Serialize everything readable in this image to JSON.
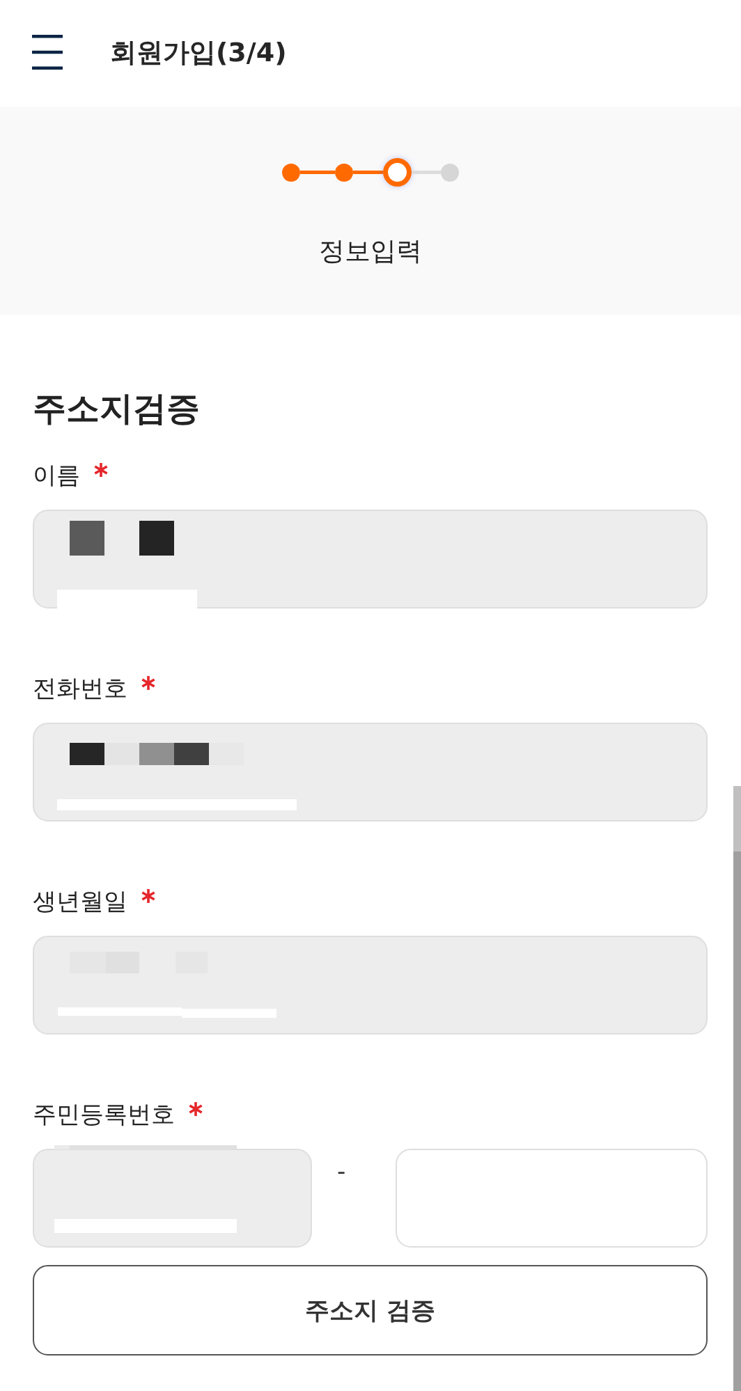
{
  "header": {
    "title": "회원가입(3/4)"
  },
  "stepper": {
    "steps": [
      {
        "completed": true,
        "selected": false
      },
      {
        "completed": true,
        "selected": false
      },
      {
        "completed": false,
        "selected": true
      },
      {
        "completed": false,
        "selected": false
      }
    ],
    "label": "정보입력"
  },
  "section": {
    "title": "주소지검증"
  },
  "fields": [
    {
      "label": "이름",
      "required": true,
      "disabled": true,
      "redacted": true
    },
    {
      "label": "전화번호",
      "required": true,
      "disabled": true,
      "redacted": true
    },
    {
      "label": "생년월일",
      "required": true,
      "disabled": true,
      "redacted": true
    }
  ],
  "rrn": {
    "label": "주민등록번호",
    "required": true,
    "separator": "-",
    "inputs": [
      {
        "disabled": true,
        "redacted": true
      },
      {
        "disabled": false,
        "redacted": false
      }
    ]
  },
  "button": {
    "label": "주소지 검증"
  }
}
